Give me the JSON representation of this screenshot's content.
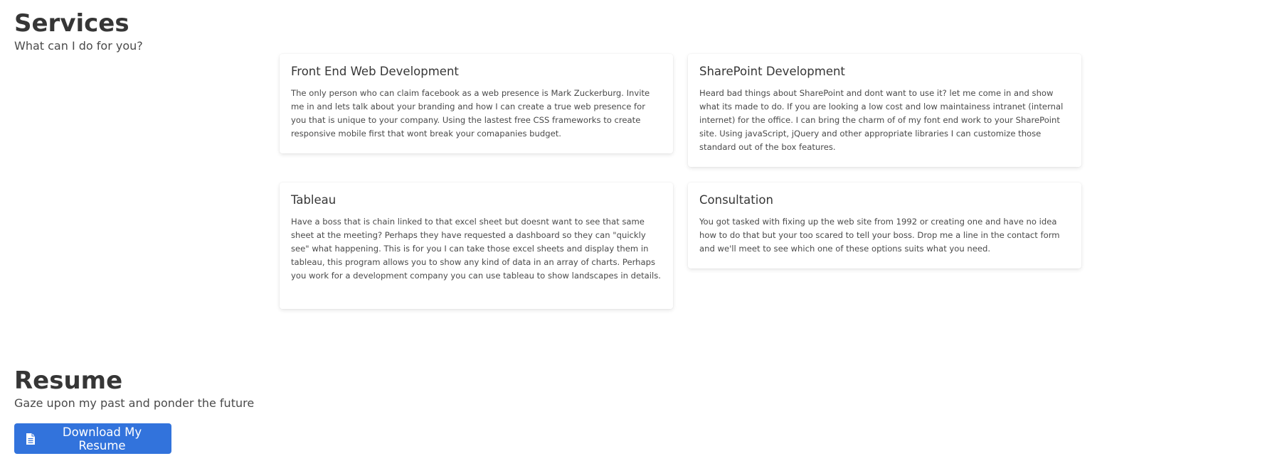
{
  "services": {
    "title": "Services",
    "subtitle": "What can I do for you?",
    "cards": [
      {
        "title": "Front End Web Development",
        "body": "The only person who can claim facebook as a web presence is Mark Zuckerburg. Invite me in and lets talk about your branding and how I can create a true web presence for you that is unique to your company. Using the lastest free CSS frameworks to create responsive mobile first that wont break your comapanies budget."
      },
      {
        "title": "SharePoint Development",
        "body": "Heard bad things about SharePoint and dont want to use it? let me come in and show what its made to do. If you are looking a low cost and low maintainess intranet (internal internet) for the office. I can bring the charm of of my font end work to your SharePoint site. Using javaScript, jQuery and other appropriate libraries I can customize those standard out of the box features."
      },
      {
        "title": "Tableau",
        "body": "Have a boss that is chain linked to that excel sheet but doesnt want to see that same sheet at the meeting? Perhaps they have requested a dashboard so they can \"quickly see\" what happening. This is for you I can take those excel sheets and display them in tableau, this program allows you to show any kind of data in an array of charts. Perhaps you work for a development company you can use tableau to show landscapes in details."
      },
      {
        "title": "Consultation",
        "body": "You got tasked with fixing up the web site from 1992 or creating one and have no idea how to do that but your too scared to tell your boss. Drop me a line in the contact form and we'll meet to see which one of these options suits what you need."
      }
    ]
  },
  "resume": {
    "title": "Resume",
    "subtitle": "Gaze upon my past and ponder the future",
    "download_label": "Download My Resume",
    "download_icon": "file-icon"
  },
  "colors": {
    "accent": "#3273dc",
    "text": "#363636"
  }
}
